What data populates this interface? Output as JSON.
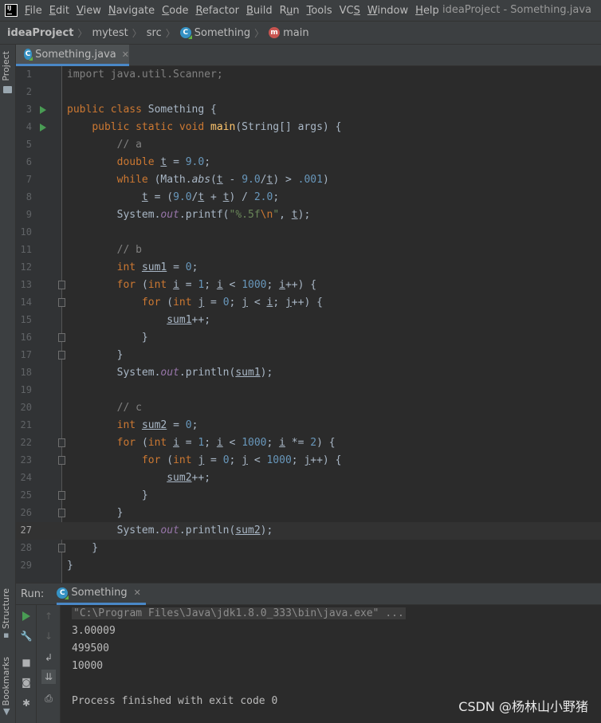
{
  "menu": {
    "items": [
      {
        "label": "File",
        "mnemonic": "F",
        "rest": "ile"
      },
      {
        "label": "Edit",
        "mnemonic": "E",
        "rest": "dit"
      },
      {
        "label": "View",
        "mnemonic": "V",
        "rest": "iew"
      },
      {
        "label": "Navigate",
        "mnemonic": "N",
        "rest": "avigate"
      },
      {
        "label": "Code",
        "mnemonic": "C",
        "rest": "ode"
      },
      {
        "label": "Refactor",
        "mnemonic": "R",
        "rest": "efactor"
      },
      {
        "label": "Build",
        "mnemonic": "B",
        "rest": "uild"
      },
      {
        "label": "Run",
        "mnemonic": "u",
        "pre": "R",
        "rest": "n"
      },
      {
        "label": "Tools",
        "mnemonic": "T",
        "rest": "ools"
      },
      {
        "label": "VCS",
        "mnemonic": "S",
        "pre": "VC",
        "rest": ""
      },
      {
        "label": "Window",
        "mnemonic": "W",
        "rest": "indow"
      },
      {
        "label": "Help",
        "mnemonic": "H",
        "rest": "elp"
      }
    ],
    "window_title": "ideaProject - Something.java",
    "logo_text": "IJ"
  },
  "breadcrumbs": {
    "project": "ideaProject",
    "module": "mytest",
    "folder": "src",
    "class": "Something",
    "method": "main",
    "class_icon_letter": "C",
    "method_icon_letter": "m"
  },
  "left_strip": {
    "project_label": "Project",
    "structure_label": "Structure",
    "bookmarks_label": "Bookmarks"
  },
  "editor": {
    "tab_label": "Something.java",
    "tab_close": "✕",
    "current_line": 27,
    "lines": [
      {
        "n": "1",
        "html": "<span class=\"unused\">import java.util.Scanner;</span>"
      },
      {
        "n": "2",
        "html": ""
      },
      {
        "n": "3",
        "html": "<span class=\"kw\">public class </span>Something {",
        "run": true
      },
      {
        "n": "4",
        "html": "    <span class=\"kw\">public static void </span><span class=\"fn\">main</span>(String[] args) {",
        "run": true
      },
      {
        "n": "5",
        "html": "        <span class=\"cmt\">// a</span>"
      },
      {
        "n": "6",
        "html": "        <span class=\"kw\">double </span><span class=\"ulv\">t</span> = <span class=\"num\">9.0</span>;"
      },
      {
        "n": "7",
        "html": "        <span class=\"kw\">while </span>(Math.<span class=\"ital\">abs</span>(<span class=\"ulv\">t</span> - <span class=\"num\">9.0</span>/<span class=\"ulv\">t</span>) &gt; <span class=\"num\">.001</span>)"
      },
      {
        "n": "8",
        "html": "            <span class=\"ulv\">t</span> = (<span class=\"num\">9.0</span>/<span class=\"ulv\">t</span> + <span class=\"ulv\">t</span>) / <span class=\"num\">2.0</span>;"
      },
      {
        "n": "9",
        "html": "        System.<span class=\"fld\">out</span>.printf(<span class=\"str\">\"%.5f</span><span class=\"kw\">\\n</span><span class=\"str\">\"</span>, <span class=\"ulv\">t</span>);"
      },
      {
        "n": "10",
        "html": ""
      },
      {
        "n": "11",
        "html": "        <span class=\"cmt\">// b</span>"
      },
      {
        "n": "12",
        "html": "        <span class=\"kw\">int </span><span class=\"ulv\">sum1</span> = <span class=\"num\">0</span>;"
      },
      {
        "n": "13",
        "html": "        <span class=\"kw\">for </span>(<span class=\"kw\">int </span><span class=\"ulv\">i</span> = <span class=\"num\">1</span>; <span class=\"ulv\">i</span> &lt; <span class=\"num\">1000</span>; <span class=\"ulv\">i</span>++) {",
        "fold": true
      },
      {
        "n": "14",
        "html": "            <span class=\"kw\">for </span>(<span class=\"kw\">int </span><span class=\"ulv\">j</span> = <span class=\"num\">0</span>; <span class=\"ulv\">j</span> &lt; <span class=\"ulv\">i</span>; <span class=\"ulv\">j</span>++) {",
        "fold": true
      },
      {
        "n": "15",
        "html": "                <span class=\"ulv\">sum1</span>++;"
      },
      {
        "n": "16",
        "html": "            }",
        "fold": true
      },
      {
        "n": "17",
        "html": "        }",
        "fold": true
      },
      {
        "n": "18",
        "html": "        System.<span class=\"fld\">out</span>.println(<span class=\"ulv\">sum1</span>);"
      },
      {
        "n": "19",
        "html": ""
      },
      {
        "n": "20",
        "html": "        <span class=\"cmt\">// c</span>"
      },
      {
        "n": "21",
        "html": "        <span class=\"kw\">int </span><span class=\"ulv\">sum2</span> = <span class=\"num\">0</span>;"
      },
      {
        "n": "22",
        "html": "        <span class=\"kw\">for </span>(<span class=\"kw\">int </span><span class=\"ulv\">i</span> = <span class=\"num\">1</span>; <span class=\"ulv\">i</span> &lt; <span class=\"num\">1000</span>; <span class=\"ulv\">i</span> *= <span class=\"num\">2</span>) {",
        "fold": true
      },
      {
        "n": "23",
        "html": "            <span class=\"kw\">for </span>(<span class=\"kw\">int </span><span class=\"ulv\">j</span> = <span class=\"num\">0</span>; <span class=\"ulv\">j</span> &lt; <span class=\"num\">1000</span>; <span class=\"ulv\">j</span>++) {",
        "fold": true
      },
      {
        "n": "24",
        "html": "                <span class=\"ulv\">sum2</span>++;"
      },
      {
        "n": "25",
        "html": "            }",
        "fold": true
      },
      {
        "n": "26",
        "html": "        }",
        "fold": true
      },
      {
        "n": "27",
        "html": "        System.<span class=\"fld\">out</span>.println(<span class=\"ulv\">sum2</span>);"
      },
      {
        "n": "28",
        "html": "    }",
        "fold": true
      },
      {
        "n": "29",
        "html": "}"
      }
    ]
  },
  "run_panel": {
    "title": "Run:",
    "tab_label": "Something",
    "tab_close": "✕",
    "command": "\"C:\\Program Files\\Java\\jdk1.8.0_333\\bin\\java.exe\" ...",
    "output": [
      "3.00009",
      "499500",
      "10000"
    ],
    "exit_message": "Process finished with exit code 0"
  },
  "watermark": "CSDN @杨林山小野猪",
  "colors": {
    "background": "#2b2b2b",
    "keyword": "#cc7832",
    "number": "#6897bb",
    "string": "#6a8759",
    "comment": "#808080",
    "method": "#ffc66d",
    "field": "#9876aa",
    "run_green": "#499c54",
    "tab_accent": "#4a88c7"
  }
}
